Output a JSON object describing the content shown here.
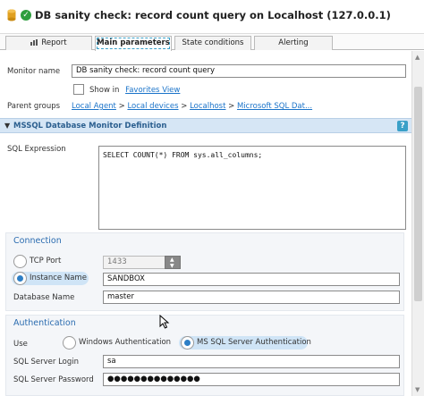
{
  "window": {
    "title": "DB sanity check: record count query on Localhost (127.0.0.1)"
  },
  "tabs": [
    {
      "label": "Report"
    },
    {
      "label": "Main parameters"
    },
    {
      "label": "State conditions"
    },
    {
      "label": "Alerting"
    }
  ],
  "general": {
    "monitor_name_label": "Monitor name",
    "monitor_name_value": "DB sanity check: record count query",
    "show_in_label": "Show in",
    "favorites_link": "Favorites View",
    "parent_groups_label": "Parent groups",
    "parent_groups": [
      {
        "label": "Local Agent"
      },
      {
        "label": "Local devices"
      },
      {
        "label": "Localhost"
      },
      {
        "label": "Microsoft SQL Dat..."
      }
    ],
    "separator": ">"
  },
  "definition": {
    "header": "MSSQL Database Monitor Definition",
    "help": "?",
    "sql_label": "SQL Expression",
    "sql_value": "SELECT COUNT(*) FROM sys.all_columns;"
  },
  "connection": {
    "title": "Connection",
    "tcp_port_label": "TCP Port",
    "tcp_port_value": "1433",
    "instance_name_label": "Instance Name",
    "instance_name_value": "SANDBOX",
    "database_name_label": "Database Name",
    "database_name_value": "master"
  },
  "authentication": {
    "title": "Authentication",
    "use_label": "Use",
    "windows_auth_label": "Windows Authentication",
    "sql_auth_label": "MS SQL Server Authentication",
    "login_label": "SQL Server Login",
    "login_value": "sa",
    "password_label": "SQL Server Password",
    "password_value": "●●●●●●●●●●●●●●"
  },
  "colors": {
    "accent": "#2b6cb0",
    "link": "#1a73c9",
    "selected_radio": "#cfe4f6",
    "header_band": "#d6e6f5",
    "status_ok": "#2e9e3e"
  }
}
